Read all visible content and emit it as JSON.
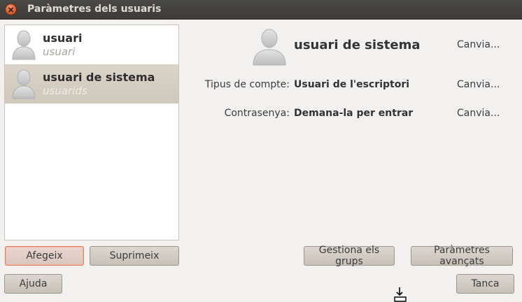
{
  "window": {
    "title": "Paràmetres dels usuaris"
  },
  "users": [
    {
      "name": "usuari",
      "login": "usuari",
      "icon": "user-avatar-icon"
    },
    {
      "name": "usuari de sistema",
      "login": "usuarids",
      "icon": "user-avatar-icon"
    }
  ],
  "detail": {
    "name": "usuari de sistema",
    "account_type_label": "Tipus de compte:",
    "account_type_value": "Usuari de l'escriptori",
    "password_label": "Contrasenya:",
    "password_value": "Demana-la per entrar",
    "change_label": "Canvia..."
  },
  "buttons": {
    "add": "Afegeix",
    "remove": "Suprimeix",
    "manage_groups": "Gestiona els grups",
    "advanced": "Paràmetres avançats",
    "help": "Ajuda",
    "close": "Tanca"
  },
  "colors": {
    "titlebar": "#3c3b37",
    "selection": "#d4cdc2",
    "focus": "#e07a5f"
  }
}
